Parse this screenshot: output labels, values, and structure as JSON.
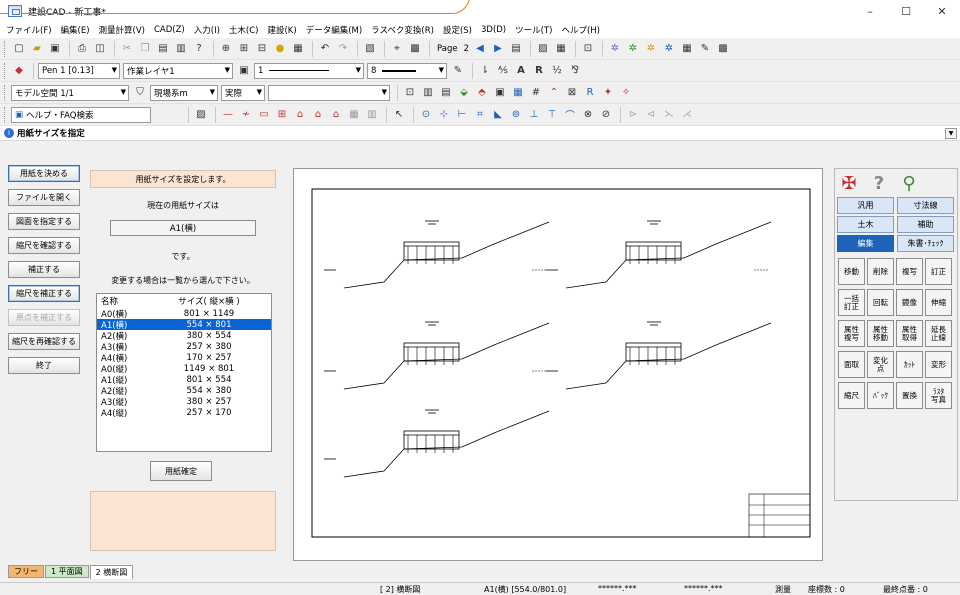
{
  "window": {
    "title": "建設CAD - 新工事*",
    "minimize": "–",
    "maximize": "☐",
    "close": "✕"
  },
  "menu": [
    "ファイル(F)",
    "編集(E)",
    "測量計算(V)",
    "CAD(Z)",
    "入力(I)",
    "土木(C)",
    "建設(K)",
    "データ編集(M)",
    "ラスベク変換(R)",
    "設定(S)",
    "3D(D)",
    "ツール(T)",
    "ヘルプ(H)"
  ],
  "toolbar1": {
    "page_label": "Page",
    "page_number": "2"
  },
  "toolbar2": {
    "pen": "Pen 1 [0.13]",
    "layer": "作業レイヤ1",
    "line": "1",
    "size": "8"
  },
  "toolbar3": {
    "model_space": "モデル空間 1/1",
    "coord_system": "現場系m",
    "scale_mode": "実際",
    "empty_combo": ""
  },
  "toolbar4": {
    "help_label": "ヘルプ・FAQ検索"
  },
  "command": {
    "icon": "i",
    "text": "用紙サイズを指定"
  },
  "left_buttons": [
    {
      "label": "用紙を決める",
      "state": "active"
    },
    {
      "label": "ファイルを開く",
      "state": "normal"
    },
    {
      "label": "図面を指定する",
      "state": "normal"
    },
    {
      "label": "縮尺を確認する",
      "state": "normal"
    },
    {
      "label": "補正する",
      "state": "normal"
    },
    {
      "label": "縮尺を補正する",
      "state": "active"
    },
    {
      "label": "原点を補正する",
      "state": "disabled"
    },
    {
      "label": "縮尺を再確認する",
      "state": "normal"
    },
    {
      "label": "終了",
      "state": "normal"
    }
  ],
  "dialog": {
    "prompt": "用紙サイズを設定します。",
    "current_label": "現在の用紙サイズは",
    "current_size": "A1(横)",
    "desu": "です。",
    "change_label": "変更する場合は一覧から選んで下さい。",
    "list_header": {
      "name": "名称",
      "size": "サイズ( 縦×横 )"
    },
    "list": [
      {
        "name": "A0(横)",
        "size": "801 × 1149"
      },
      {
        "name": "A1(横)",
        "size": "554 × 801",
        "selected": true
      },
      {
        "name": "A2(横)",
        "size": "380 × 554"
      },
      {
        "name": "A3(横)",
        "size": "257 × 380"
      },
      {
        "name": "A4(横)",
        "size": "170 × 257"
      },
      {
        "name": "A0(縦)",
        "size": "1149 × 801"
      },
      {
        "name": "A1(縦)",
        "size": "801 × 554"
      },
      {
        "name": "A2(縦)",
        "size": "554 × 380"
      },
      {
        "name": "A3(縦)",
        "size": "380 × 257"
      },
      {
        "name": "A4(縦)",
        "size": "257 × 170"
      }
    ],
    "confirm_button": "用紙確定"
  },
  "right_panel": {
    "tabs": [
      [
        "汎用",
        "寸法線"
      ],
      [
        "土木",
        "補助"
      ],
      [
        "編集",
        "朱書･ﾁｪｯｸ"
      ]
    ],
    "selected_tab": "編集",
    "commands": [
      "移動",
      "削除",
      "複写",
      "訂正",
      "一括\n訂正",
      "回転",
      "鏡像",
      "伸縮",
      "属性\n複写",
      "属性\n移動",
      "属性\n取得",
      "延長\n止線",
      "面取",
      "変化\n点",
      "ｶｯﾄ",
      "変形",
      "縮尺",
      "ﾊﾞｯｸ",
      "置換",
      "ﾗｽﾀ\n写真"
    ],
    "icons": [
      "hammer-icon",
      "help-icon",
      "zoom-icon"
    ]
  },
  "sheet_tabs": [
    "フリー",
    "1 平面図",
    "2 横断図"
  ],
  "selected_sheet": "2 横断図",
  "status": {
    "sheet": "[ 2] 横断図",
    "paper": "A1(横) [554.0/801.0]",
    "x": "******.***",
    "y": "******.***",
    "mode": "測量",
    "coord_count": "座標数 : 0",
    "last_point": "最終点番 : 0"
  },
  "colors": {
    "accent": "#1e63b8",
    "selection": "#0a64d6",
    "prompt_bg": "#fbe4d2",
    "orange": "#e07a1f"
  }
}
